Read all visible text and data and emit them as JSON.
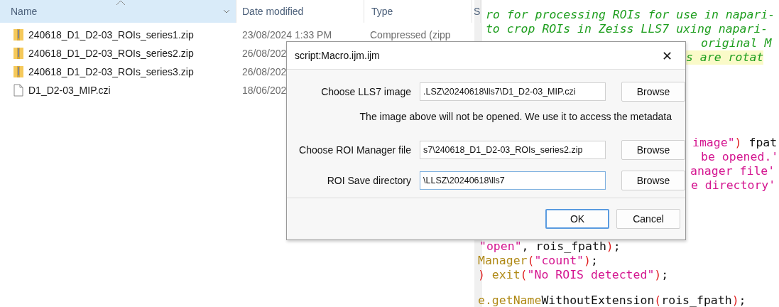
{
  "explorer": {
    "columns": [
      {
        "label": "Name",
        "sorted": true
      },
      {
        "label": "Date modified",
        "sorted": false
      },
      {
        "label": "Type",
        "sorted": false
      },
      {
        "label": "S",
        "sorted": false
      }
    ],
    "files": [
      {
        "kind": "zip",
        "name": "240618_D1_D2-03_ROIs_series1.zip",
        "date": "23/08/2024 1:33 PM",
        "type": "Compressed (zipp"
      },
      {
        "kind": "zip",
        "name": "240618_D1_D2-03_ROIs_series2.zip",
        "date": "26/08/202"
      },
      {
        "kind": "zip",
        "name": "240618_D1_D2-03_ROIs_series3.zip",
        "date": "26/08/202"
      },
      {
        "kind": "file",
        "name": "D1_D2-03_MIP.czi",
        "date": "18/06/202"
      }
    ]
  },
  "editor": {
    "lines": [
      {
        "highlighted": false,
        "segments": [
          {
            "kind": "comment",
            "text": "ro for processing ROIs for use in napari-"
          }
        ]
      },
      {
        "highlighted": false,
        "segments": [
          {
            "kind": "comment",
            "text": " to crop ROIs in Zeiss LLS7 uxing napari-"
          }
        ]
      },
      {
        "highlighted": false,
        "segments": [
          {
            "kind": "comment",
            "text": "original M"
          }
        ]
      },
      {
        "highlighted": true,
        "segments": [
          {
            "kind": "comment",
            "text": "s are rotat"
          }
        ]
      },
      {
        "highlighted": false,
        "segments": [
          {
            "kind": "string",
            "text": "image\""
          },
          {
            "kind": "paren",
            "text": ")"
          },
          {
            "kind": "plain",
            "text": " fpat"
          }
        ]
      },
      {
        "highlighted": false,
        "segments": [
          {
            "kind": "string",
            "text": "be opened.'"
          }
        ]
      },
      {
        "highlighted": false,
        "segments": [
          {
            "kind": "string",
            "text": "anager file'"
          }
        ]
      },
      {
        "highlighted": false,
        "segments": [
          {
            "kind": "string",
            "text": "e directory'"
          }
        ]
      },
      {
        "highlighted": false,
        "segments": [
          {
            "kind": "string",
            "text": "\"open\""
          },
          {
            "kind": "plain",
            "text": ", rois_fpath"
          },
          {
            "kind": "paren",
            "text": ")"
          },
          {
            "kind": "plain",
            "text": ";"
          }
        ]
      },
      {
        "highlighted": false,
        "segments": [
          {
            "kind": "func",
            "text": "Manager"
          },
          {
            "kind": "paren",
            "text": "("
          },
          {
            "kind": "string",
            "text": "\"count\""
          },
          {
            "kind": "paren",
            "text": ")"
          },
          {
            "kind": "plain",
            "text": ";"
          }
        ]
      },
      {
        "highlighted": false,
        "segments": [
          {
            "kind": "paren",
            "text": ")"
          },
          {
            "kind": "func",
            "text": " exit"
          },
          {
            "kind": "paren",
            "text": "("
          },
          {
            "kind": "string",
            "text": "\"No ROIS detected\""
          },
          {
            "kind": "paren",
            "text": ")"
          },
          {
            "kind": "plain",
            "text": ";"
          }
        ]
      },
      {
        "highlighted": false,
        "segments": [
          {
            "kind": "func",
            "text": "e.getName"
          },
          {
            "kind": "plain",
            "text": "WithoutExtension"
          },
          {
            "kind": "paren",
            "text": "("
          },
          {
            "kind": "plain",
            "text": "rois_fpath"
          },
          {
            "kind": "paren",
            "text": ")"
          },
          {
            "kind": "plain",
            "text": ";"
          }
        ]
      }
    ]
  },
  "dialog": {
    "title": "script:Macro.ijm.ijm",
    "close": "✕",
    "fields": [
      {
        "label": "Choose LLS7 image",
        "value": ".LSZ\\20240618\\lls7\\D1_D2-03_MIP.czi",
        "button": "Browse",
        "focused": false
      },
      {
        "label": "Choose ROI Manager file",
        "value": "s7\\240618_D1_D2-03_ROIs_series2.zip",
        "button": "Browse",
        "focused": false
      },
      {
        "label": "ROI Save directory",
        "value": "\\LLSZ\\20240618\\lls7",
        "button": "Browse",
        "focused": true
      }
    ],
    "message": "The image above will not be opened. We use it to access the metadata",
    "buttons": [
      {
        "label": "OK",
        "default": true
      },
      {
        "label": "Cancel",
        "default": false
      }
    ]
  }
}
